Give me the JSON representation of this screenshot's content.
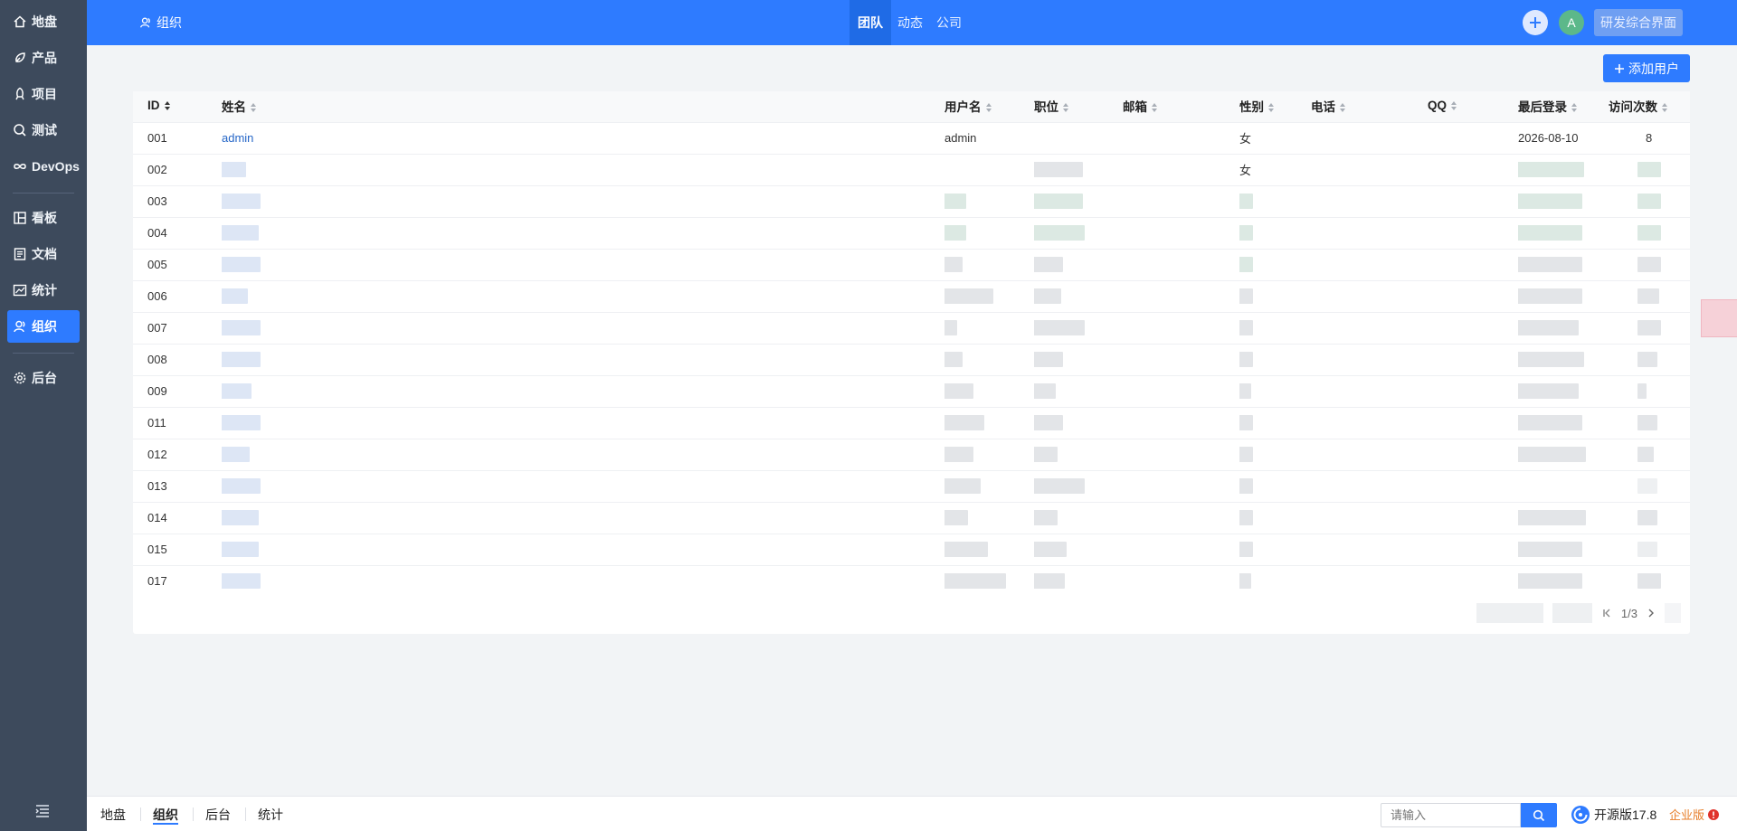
{
  "sidebar": {
    "items": [
      {
        "label": "地盘",
        "icon": "home-icon"
      },
      {
        "label": "产品",
        "icon": "product-icon"
      },
      {
        "label": "项目",
        "icon": "project-icon"
      },
      {
        "label": "测试",
        "icon": "test-icon"
      },
      {
        "label": "DevOps",
        "icon": "devops-icon"
      },
      {
        "label": "看板",
        "icon": "kanban-icon"
      },
      {
        "label": "文档",
        "icon": "doc-icon"
      },
      {
        "label": "统计",
        "icon": "stats-icon"
      },
      {
        "label": "组织",
        "icon": "org-icon"
      },
      {
        "label": "后台",
        "icon": "gear-icon"
      }
    ],
    "active": "组织"
  },
  "header": {
    "title": "组织",
    "tabs": [
      "团队",
      "动态",
      "公司"
    ],
    "active_tab": "团队",
    "avatar_letter": "A",
    "workspace_button": "研发综合界面"
  },
  "toolbar": {
    "add_user": "添加用户"
  },
  "table": {
    "columns": [
      "ID",
      "姓名",
      "用户名",
      "职位",
      "邮箱",
      "性别",
      "电话",
      "QQ",
      "最后登录",
      "访问次数"
    ],
    "rows": [
      {
        "id": "001",
        "name": "admin",
        "username": "admin",
        "gender": "女",
        "last_login": "2026-08-10",
        "visits": "8"
      },
      {
        "id": "002",
        "gender": "女"
      },
      {
        "id": "003"
      },
      {
        "id": "004"
      },
      {
        "id": "005"
      },
      {
        "id": "006"
      },
      {
        "id": "007"
      },
      {
        "id": "008"
      },
      {
        "id": "009"
      },
      {
        "id": "011"
      },
      {
        "id": "012"
      },
      {
        "id": "013"
      },
      {
        "id": "014"
      },
      {
        "id": "015"
      },
      {
        "id": "017"
      }
    ]
  },
  "pager": {
    "page_text": "1/3"
  },
  "footer": {
    "crumbs": [
      "地盘",
      "组织",
      "后台",
      "统计"
    ],
    "active_crumb": "组织",
    "search_placeholder": "请输入",
    "version": "开源版17.8",
    "edition": "企业版"
  },
  "colors": {
    "primary": "#2e7bff",
    "sidebar": "#3d4a5c",
    "edition": "#e77d28"
  }
}
